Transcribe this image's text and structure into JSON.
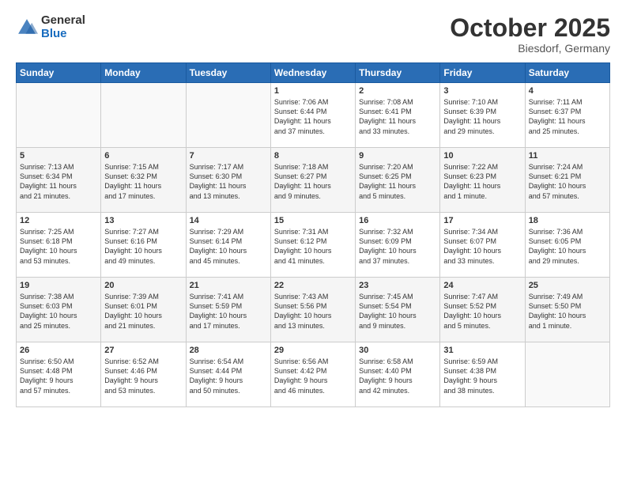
{
  "header": {
    "logo_general": "General",
    "logo_blue": "Blue",
    "month": "October 2025",
    "location": "Biesdorf, Germany"
  },
  "days_of_week": [
    "Sunday",
    "Monday",
    "Tuesday",
    "Wednesday",
    "Thursday",
    "Friday",
    "Saturday"
  ],
  "weeks": [
    [
      {
        "day": "",
        "info": ""
      },
      {
        "day": "",
        "info": ""
      },
      {
        "day": "",
        "info": ""
      },
      {
        "day": "1",
        "info": "Sunrise: 7:06 AM\nSunset: 6:44 PM\nDaylight: 11 hours\nand 37 minutes."
      },
      {
        "day": "2",
        "info": "Sunrise: 7:08 AM\nSunset: 6:41 PM\nDaylight: 11 hours\nand 33 minutes."
      },
      {
        "day": "3",
        "info": "Sunrise: 7:10 AM\nSunset: 6:39 PM\nDaylight: 11 hours\nand 29 minutes."
      },
      {
        "day": "4",
        "info": "Sunrise: 7:11 AM\nSunset: 6:37 PM\nDaylight: 11 hours\nand 25 minutes."
      }
    ],
    [
      {
        "day": "5",
        "info": "Sunrise: 7:13 AM\nSunset: 6:34 PM\nDaylight: 11 hours\nand 21 minutes."
      },
      {
        "day": "6",
        "info": "Sunrise: 7:15 AM\nSunset: 6:32 PM\nDaylight: 11 hours\nand 17 minutes."
      },
      {
        "day": "7",
        "info": "Sunrise: 7:17 AM\nSunset: 6:30 PM\nDaylight: 11 hours\nand 13 minutes."
      },
      {
        "day": "8",
        "info": "Sunrise: 7:18 AM\nSunset: 6:27 PM\nDaylight: 11 hours\nand 9 minutes."
      },
      {
        "day": "9",
        "info": "Sunrise: 7:20 AM\nSunset: 6:25 PM\nDaylight: 11 hours\nand 5 minutes."
      },
      {
        "day": "10",
        "info": "Sunrise: 7:22 AM\nSunset: 6:23 PM\nDaylight: 11 hours\nand 1 minute."
      },
      {
        "day": "11",
        "info": "Sunrise: 7:24 AM\nSunset: 6:21 PM\nDaylight: 10 hours\nand 57 minutes."
      }
    ],
    [
      {
        "day": "12",
        "info": "Sunrise: 7:25 AM\nSunset: 6:18 PM\nDaylight: 10 hours\nand 53 minutes."
      },
      {
        "day": "13",
        "info": "Sunrise: 7:27 AM\nSunset: 6:16 PM\nDaylight: 10 hours\nand 49 minutes."
      },
      {
        "day": "14",
        "info": "Sunrise: 7:29 AM\nSunset: 6:14 PM\nDaylight: 10 hours\nand 45 minutes."
      },
      {
        "day": "15",
        "info": "Sunrise: 7:31 AM\nSunset: 6:12 PM\nDaylight: 10 hours\nand 41 minutes."
      },
      {
        "day": "16",
        "info": "Sunrise: 7:32 AM\nSunset: 6:09 PM\nDaylight: 10 hours\nand 37 minutes."
      },
      {
        "day": "17",
        "info": "Sunrise: 7:34 AM\nSunset: 6:07 PM\nDaylight: 10 hours\nand 33 minutes."
      },
      {
        "day": "18",
        "info": "Sunrise: 7:36 AM\nSunset: 6:05 PM\nDaylight: 10 hours\nand 29 minutes."
      }
    ],
    [
      {
        "day": "19",
        "info": "Sunrise: 7:38 AM\nSunset: 6:03 PM\nDaylight: 10 hours\nand 25 minutes."
      },
      {
        "day": "20",
        "info": "Sunrise: 7:39 AM\nSunset: 6:01 PM\nDaylight: 10 hours\nand 21 minutes."
      },
      {
        "day": "21",
        "info": "Sunrise: 7:41 AM\nSunset: 5:59 PM\nDaylight: 10 hours\nand 17 minutes."
      },
      {
        "day": "22",
        "info": "Sunrise: 7:43 AM\nSunset: 5:56 PM\nDaylight: 10 hours\nand 13 minutes."
      },
      {
        "day": "23",
        "info": "Sunrise: 7:45 AM\nSunset: 5:54 PM\nDaylight: 10 hours\nand 9 minutes."
      },
      {
        "day": "24",
        "info": "Sunrise: 7:47 AM\nSunset: 5:52 PM\nDaylight: 10 hours\nand 5 minutes."
      },
      {
        "day": "25",
        "info": "Sunrise: 7:49 AM\nSunset: 5:50 PM\nDaylight: 10 hours\nand 1 minute."
      }
    ],
    [
      {
        "day": "26",
        "info": "Sunrise: 6:50 AM\nSunset: 4:48 PM\nDaylight: 9 hours\nand 57 minutes."
      },
      {
        "day": "27",
        "info": "Sunrise: 6:52 AM\nSunset: 4:46 PM\nDaylight: 9 hours\nand 53 minutes."
      },
      {
        "day": "28",
        "info": "Sunrise: 6:54 AM\nSunset: 4:44 PM\nDaylight: 9 hours\nand 50 minutes."
      },
      {
        "day": "29",
        "info": "Sunrise: 6:56 AM\nSunset: 4:42 PM\nDaylight: 9 hours\nand 46 minutes."
      },
      {
        "day": "30",
        "info": "Sunrise: 6:58 AM\nSunset: 4:40 PM\nDaylight: 9 hours\nand 42 minutes."
      },
      {
        "day": "31",
        "info": "Sunrise: 6:59 AM\nSunset: 4:38 PM\nDaylight: 9 hours\nand 38 minutes."
      },
      {
        "day": "",
        "info": ""
      }
    ]
  ]
}
